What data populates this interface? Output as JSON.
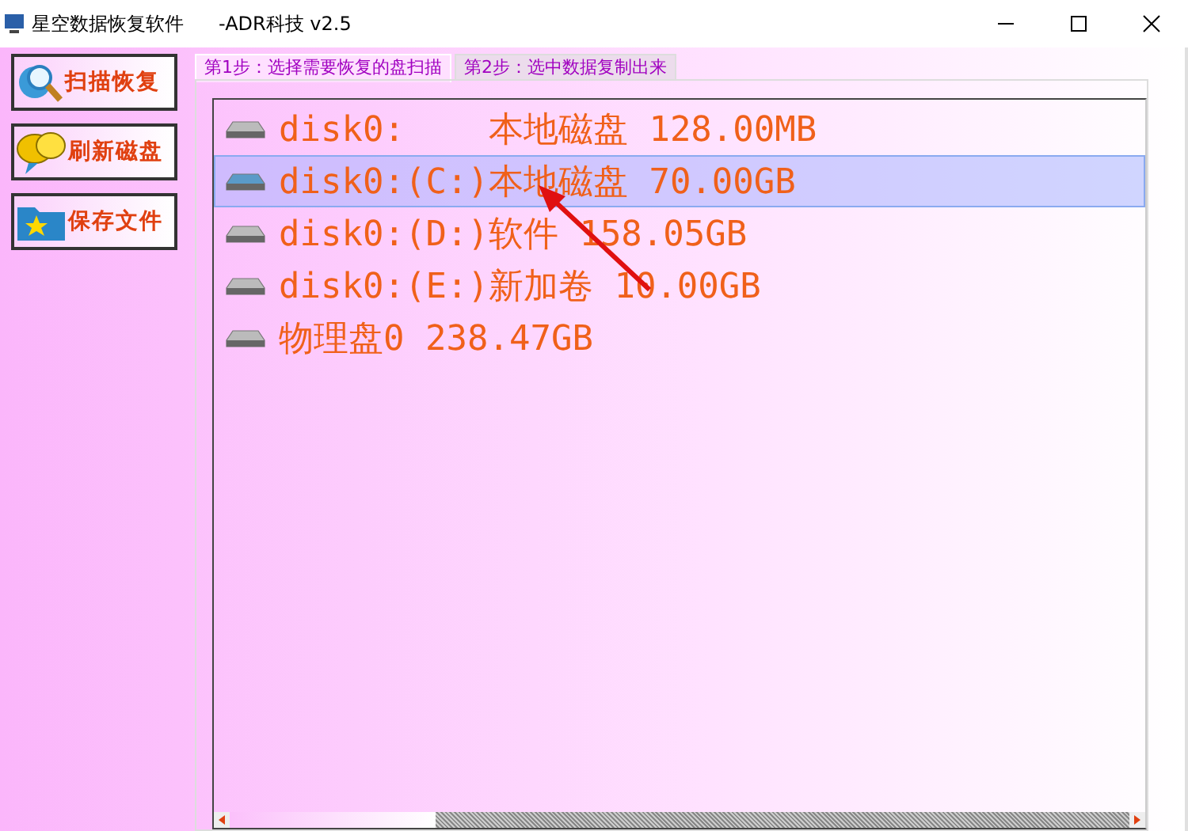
{
  "window": {
    "title": "星空数据恢复软件",
    "subtitle": "-ADR科技 v2.5"
  },
  "side_buttons": [
    {
      "kind": "scan",
      "label": "扫描恢复"
    },
    {
      "kind": "refresh",
      "label": "刷新磁盘"
    },
    {
      "kind": "save",
      "label": "保存文件"
    }
  ],
  "tabs": [
    {
      "label": "第1步：选择需要恢复的盘扫描",
      "selected": true
    },
    {
      "label": "第2步：选中数据复制出来",
      "selected": false
    }
  ],
  "disks": [
    {
      "label": "disk0:    本地磁盘 128.00MB",
      "selected": false
    },
    {
      "label": "disk0:(C:)本地磁盘 70.00GB",
      "selected": true
    },
    {
      "label": "disk0:(D:)软件 158.05GB",
      "selected": false
    },
    {
      "label": "disk0:(E:)新加卷 10.00GB",
      "selected": false
    },
    {
      "label": "物理盘0 238.47GB",
      "selected": false
    }
  ]
}
